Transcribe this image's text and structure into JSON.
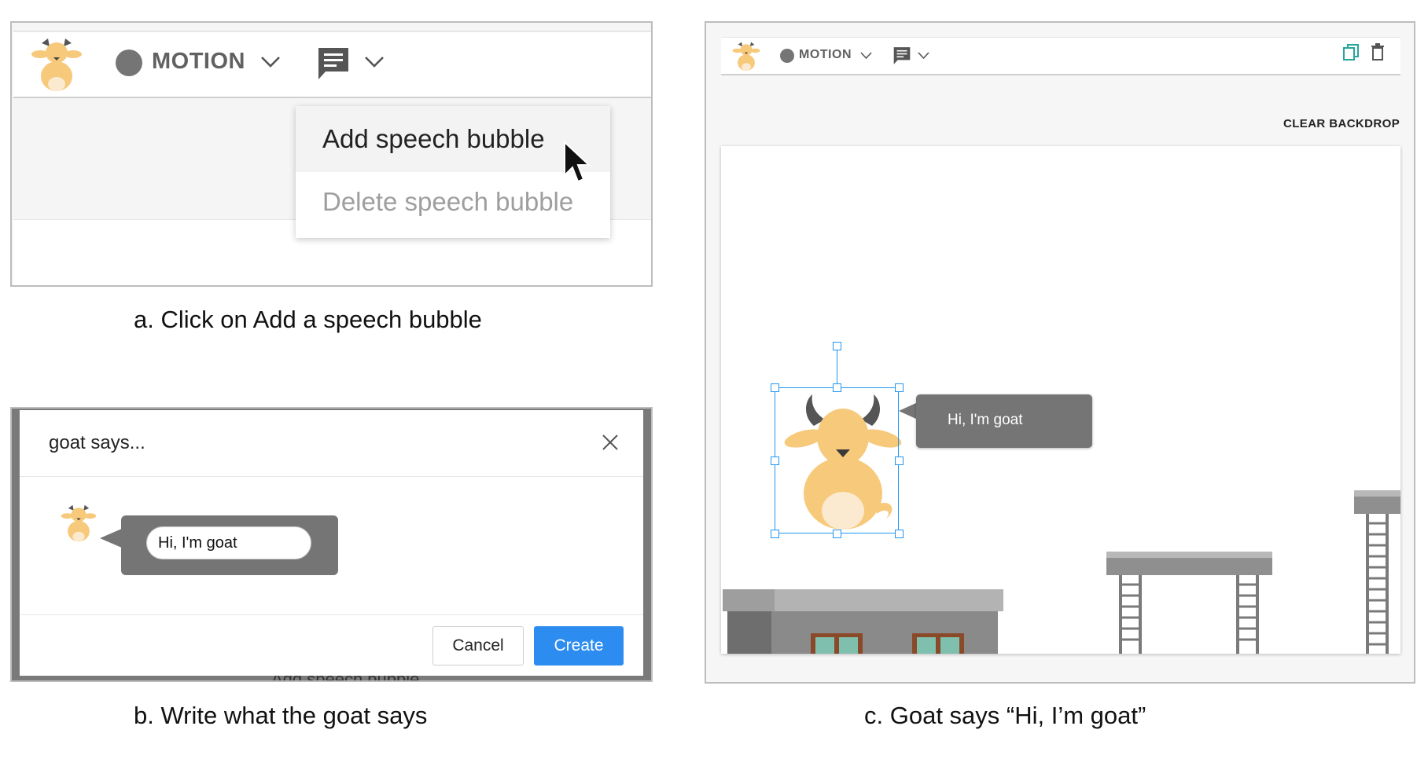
{
  "captions": {
    "a": "a. Click on Add a speech bubble",
    "b": "b. Write what the goat says",
    "c": "c. Goat says “Hi, I’m goat”"
  },
  "panel_a": {
    "toolbar": {
      "motion_label": "MOTION"
    },
    "menu": {
      "items": [
        {
          "label": "Add speech bubble",
          "enabled": true,
          "hovered": true
        },
        {
          "label": "Delete speech bubble",
          "enabled": false
        }
      ]
    }
  },
  "panel_b": {
    "dialog": {
      "title": "goat says...",
      "input_value": "Hi, I'm goat",
      "cancel_label": "Cancel",
      "create_label": "Create",
      "behind_text": "Add speech bubble"
    }
  },
  "panel_c": {
    "toolbar": {
      "motion_label": "MOTION"
    },
    "clear_backdrop_label": "CLEAR BACKDROP",
    "speech_bubble_text": "Hi, I'm goat"
  },
  "colors": {
    "accent": "#2d8cf0",
    "selection": "#2196f3",
    "bubble": "#757575",
    "goat_body": "#f7c97a",
    "copy_icon": "#26a69a"
  }
}
